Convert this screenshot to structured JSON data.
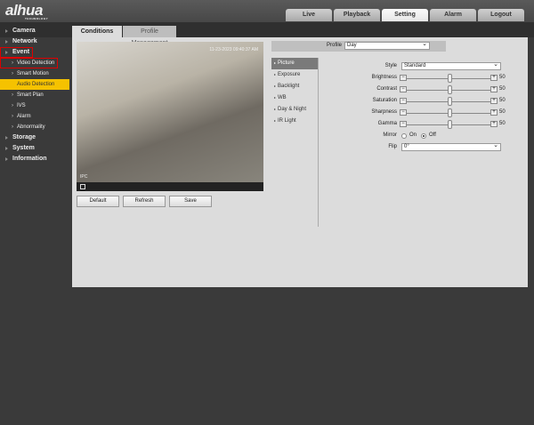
{
  "brand": {
    "logo": "alhua",
    "tagline": "TECHNOLOGY"
  },
  "top_tabs": [
    {
      "label": "Live"
    },
    {
      "label": "Playback"
    },
    {
      "label": "Setting",
      "active": true
    },
    {
      "label": "Alarm"
    },
    {
      "label": "Logout"
    }
  ],
  "sidebar": {
    "items": [
      {
        "label": "Camera",
        "type": "main"
      },
      {
        "label": "Network",
        "type": "main"
      },
      {
        "label": "Event",
        "type": "main",
        "highlight": true
      },
      {
        "label": "Video Detection",
        "type": "sub",
        "highlight": true
      },
      {
        "label": "Smart Motion Detection",
        "type": "sub"
      },
      {
        "label": "Audio Detection",
        "type": "sub",
        "selected": true
      },
      {
        "label": "Smart Plan",
        "type": "sub"
      },
      {
        "label": "IVS",
        "type": "sub"
      },
      {
        "label": "Alarm",
        "type": "sub"
      },
      {
        "label": "Abnormality",
        "type": "sub"
      },
      {
        "label": "Storage",
        "type": "main"
      },
      {
        "label": "System",
        "type": "main"
      },
      {
        "label": "Information",
        "type": "main"
      }
    ]
  },
  "page_tabs": [
    {
      "label": "Conditions",
      "active": true
    },
    {
      "label": "Profile Management"
    }
  ],
  "video": {
    "timestamp": "11-23-2023 09:40:37 AM",
    "channel": "IPC"
  },
  "buttons": {
    "default": "Default",
    "refresh": "Refresh",
    "save": "Save"
  },
  "profile": {
    "label": "Profile",
    "value": "Day"
  },
  "left_menu": [
    {
      "label": "Picture",
      "active": true
    },
    {
      "label": "Exposure"
    },
    {
      "label": "Backlight"
    },
    {
      "label": "WB"
    },
    {
      "label": "Day & Night"
    },
    {
      "label": "IR Light"
    }
  ],
  "settings": {
    "style": {
      "label": "Style",
      "value": "Standard"
    },
    "sliders": [
      {
        "label": "Brightness",
        "value": 50
      },
      {
        "label": "Contrast",
        "value": 50
      },
      {
        "label": "Saturation",
        "value": 50
      },
      {
        "label": "Sharpness",
        "value": 50
      },
      {
        "label": "Gamma",
        "value": 50
      }
    ],
    "slider_range": [
      0,
      100
    ],
    "mirror": {
      "label": "Mirror",
      "options": [
        "On",
        "Off"
      ],
      "selected": "Off"
    },
    "flip": {
      "label": "Flip",
      "value": "0°"
    }
  },
  "colors": {
    "selected_item": "#f5c200",
    "highlight_box": "#dd0000",
    "panel": "#dcdcdc"
  }
}
